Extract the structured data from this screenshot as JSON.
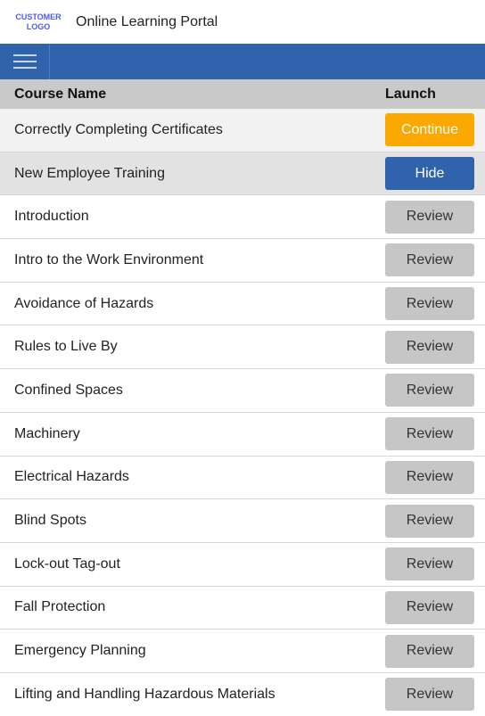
{
  "header": {
    "logo_line1": "CUSTOMER",
    "logo_line2": "LOGO",
    "title": "Online Learning Portal"
  },
  "navbar": {
    "menu_icon": "hamburger-menu-icon",
    "color": "#2f63ab"
  },
  "table": {
    "col_name": "Course Name",
    "col_launch": "Launch",
    "current_course": {
      "name": "Correctly Completing Certificates",
      "action": "Continue"
    },
    "group": {
      "name": "New Employee Training",
      "action": "Hide"
    },
    "modules": [
      {
        "name": "Introduction",
        "action": "Review"
      },
      {
        "name": "Intro to the Work Environment",
        "action": "Review"
      },
      {
        "name": "Avoidance of Hazards",
        "action": "Review"
      },
      {
        "name": "Rules to Live By",
        "action": "Review"
      },
      {
        "name": "Confined Spaces",
        "action": "Review"
      },
      {
        "name": "Machinery",
        "action": "Review"
      },
      {
        "name": "Electrical Hazards",
        "action": "Review"
      },
      {
        "name": "Blind Spots",
        "action": "Review"
      },
      {
        "name": "Lock-out Tag-out",
        "action": "Review"
      },
      {
        "name": "Fall Protection",
        "action": "Review"
      },
      {
        "name": "Emergency Planning",
        "action": "Review"
      },
      {
        "name": "Lifting and Handling Hazardous Materials",
        "action": "Review"
      }
    ]
  },
  "colors": {
    "continue": "#fba800",
    "hide": "#2f63ab",
    "review": "#c6c6c6"
  }
}
